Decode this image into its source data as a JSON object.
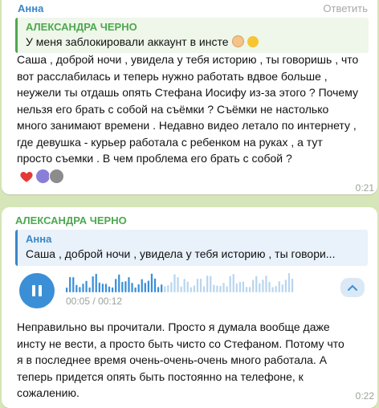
{
  "message1": {
    "sender": "Анна",
    "reply_label": "Ответить",
    "quote": {
      "author": "АЛЕКСАНДРА ЧЕРНО",
      "text": "У меня заблокировали аккаунт в инсте",
      "emojis": [
        "raised-hand-emoji",
        "sad-face-emoji"
      ]
    },
    "text": "Саша , доброй ночи , увидела у тебя историю , ты говоришь , что\nвот расслабилась и теперь нужно работать вдвое больше  ,\nнеужели ты отдашь опять Стефана Иосифу из-за этого ? Почему\nнельзя его брать с собой на съёмки ? Съёмки не настолько\nмного занимают времени . Недавно видео летало по интернету ,\nгде девушка - курьер работала с ребенком на руках , а тут\nпросто съемки . В чем проблема его брать с собой ?",
    "reactions": [
      "heart-icon",
      "avatar",
      "avatar"
    ],
    "time": "0:21"
  },
  "message2": {
    "sender": "АЛЕКСАНДРА ЧЕРНО",
    "quote": {
      "author": "Анна",
      "text": "Саша , доброй ночи , увидела у тебя историю , ты говори..."
    },
    "voice": {
      "elapsed": "00:05",
      "separator": "/",
      "total": "00:12",
      "progress": 0.42,
      "accent": "#3b8fd6"
    },
    "text": "Неправильно вы прочитали. Просто я думала вообще даже\nинсту не вести, а просто быть чисто со Стефаном. Потому что\nя в последнее время очень-очень-очень много работала. А\nтеперь придется опять быть постоянно на телефоне, к\nсожалению.",
    "time": "0:22"
  },
  "colors": {
    "background": "#d6e6b8",
    "sender_blue": "#3a86c8",
    "sender_green": "#4da84f",
    "heart": "#e53935"
  }
}
